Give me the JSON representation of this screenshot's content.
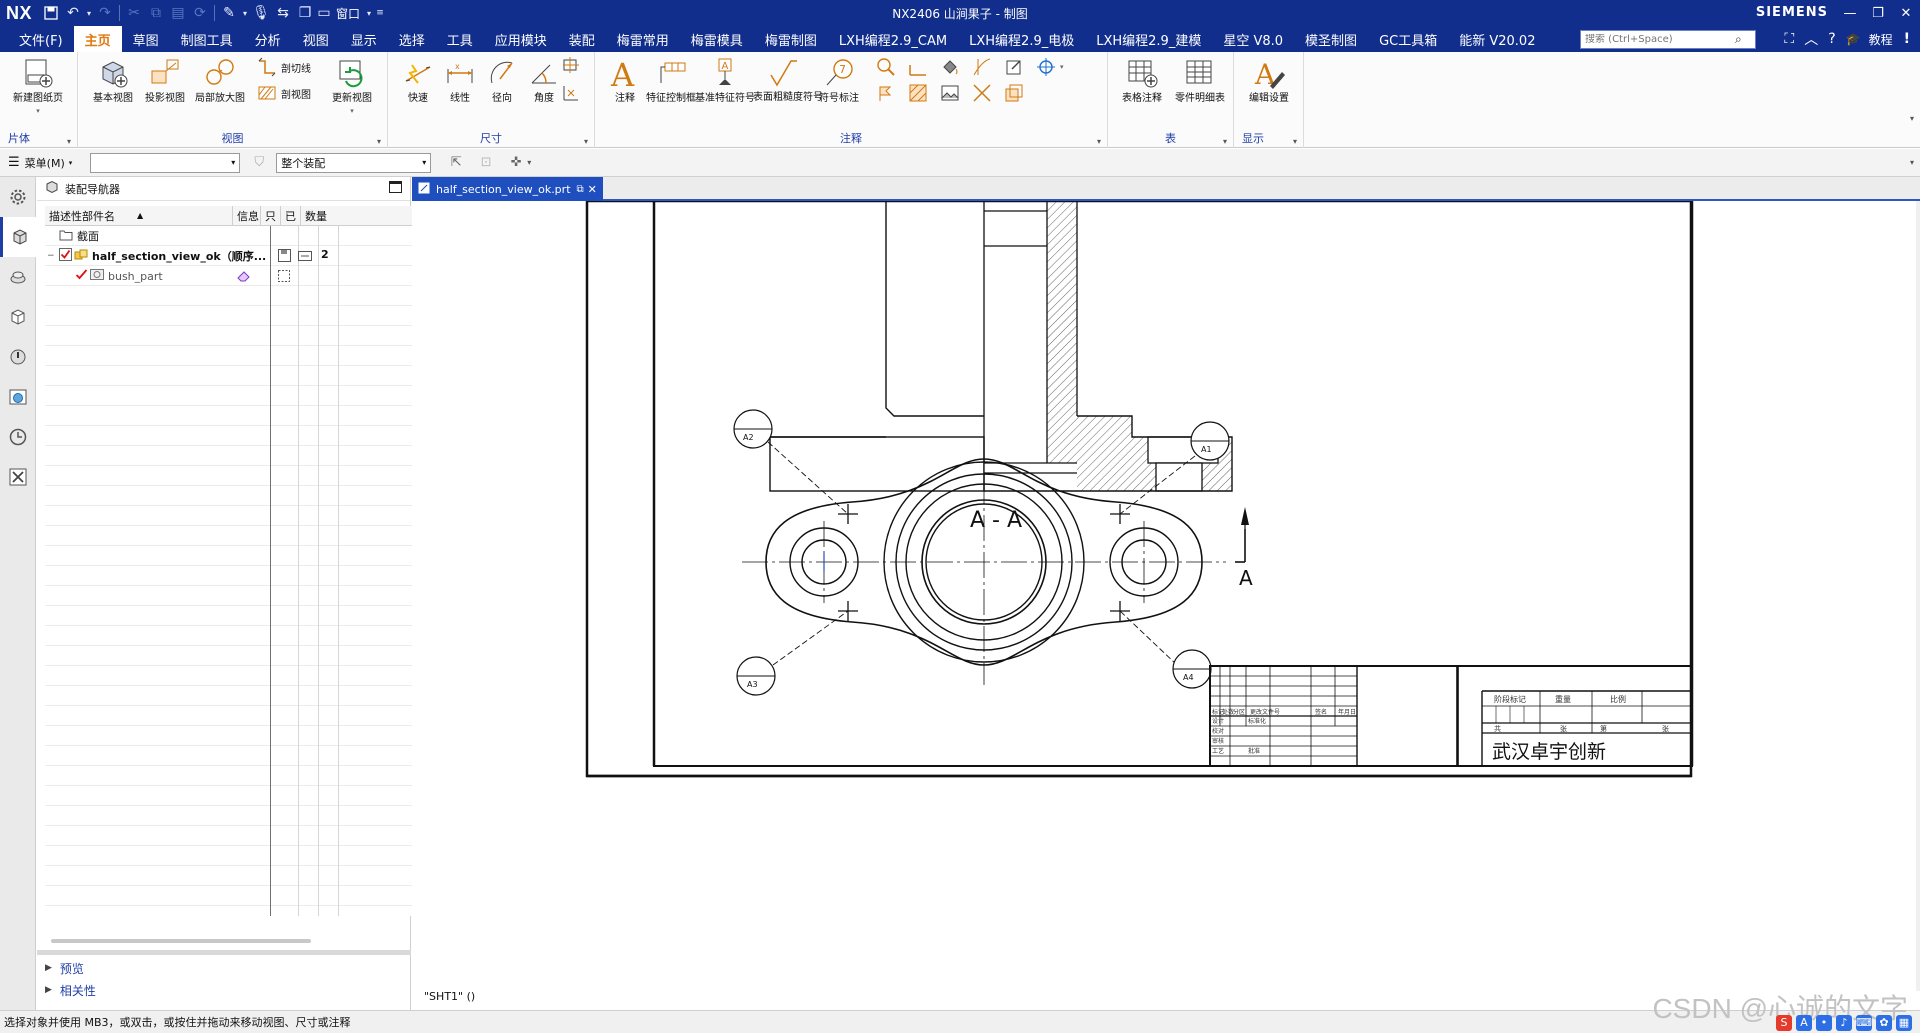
{
  "titlebar": {
    "logo": "NX",
    "title": "NX2406 山涧果子 - 制图",
    "window_menu": "窗口",
    "brand": "SIEMENS"
  },
  "menubar": {
    "tabs": [
      "文件(F)",
      "主页",
      "草图",
      "制图工具",
      "分析",
      "视图",
      "显示",
      "选择",
      "工具",
      "应用模块",
      "装配",
      "梅雷常用",
      "梅雷模具",
      "梅雷制图",
      "LXH编程2.9_CAM",
      "LXH编程2.9_电极",
      "LXH编程2.9_建模",
      "星空 V8.0",
      "模圣制图",
      "GC工具箱",
      "能新 V20.02"
    ],
    "active_tab": "主页",
    "search_placeholder": "搜索 (Ctrl+Space)",
    "tutorial": "教程"
  },
  "ribbon": {
    "groups": {
      "sheet": "片体",
      "view": "视图",
      "dimension": "尺寸",
      "annotation": "注释",
      "table": "表",
      "display": "显示"
    },
    "tools": {
      "new_sheet": "新建图纸页",
      "base_view": "基本视图",
      "projected_view": "投影视图",
      "detail_view": "局部放大图",
      "section_line": "剖切线",
      "section_view": "剖视图",
      "update_view": "更新视图",
      "rapid": "快速",
      "linear": "线性",
      "radial": "径向",
      "angular": "角度",
      "note": "注释",
      "fcf": "特征控制框",
      "datum": "基准特征符号",
      "surface_finish": "表面粗糙度符号",
      "id_symbol": "符号标注",
      "table_note": "表格注释",
      "parts_list": "零件明细表",
      "edit_settings": "编辑设置"
    }
  },
  "selbar": {
    "menu": "菜单(M)",
    "filter_value": "",
    "scope_value": "整个装配"
  },
  "navigator": {
    "title": "装配导航器",
    "columns": [
      "描述性部件名",
      "信息",
      "只",
      "已",
      "数量"
    ],
    "rows": [
      {
        "name": "截面",
        "info": "",
        "qty": ""
      },
      {
        "name": "half_section_view_ok（顺序...",
        "info": "",
        "qty": "2"
      },
      {
        "name": "bush_part",
        "info": "",
        "qty": ""
      }
    ],
    "panels": [
      "预览",
      "相关性"
    ]
  },
  "graphics": {
    "doc_tab": "half_section_view_ok.prt",
    "sheet_label": "\"SHT1\" ()",
    "drawing": {
      "section_title": "A - A",
      "section_arrow_label": "A",
      "balloons": [
        "A2",
        "A1",
        "A3",
        "A4"
      ],
      "title_block": {
        "row_labels": [
          "设计",
          "标准化",
          "校对",
          "审核",
          "工艺",
          "批准"
        ],
        "header_cells": [
          "标记",
          "处数",
          "分区",
          "更改文件号",
          "签名",
          "年月日"
        ],
        "right_cells": [
          "阶段标记",
          "重量",
          "比例"
        ],
        "sheet_cells": [
          "共",
          "张",
          "第",
          "张"
        ],
        "company": "武汉卓宇创新"
      }
    }
  },
  "statusbar": {
    "message": "选择对象并使用 MB3，或双击，或按住并拖动来移动视图、尺寸或注释",
    "watermark": "CSDN @心诚的文字"
  }
}
